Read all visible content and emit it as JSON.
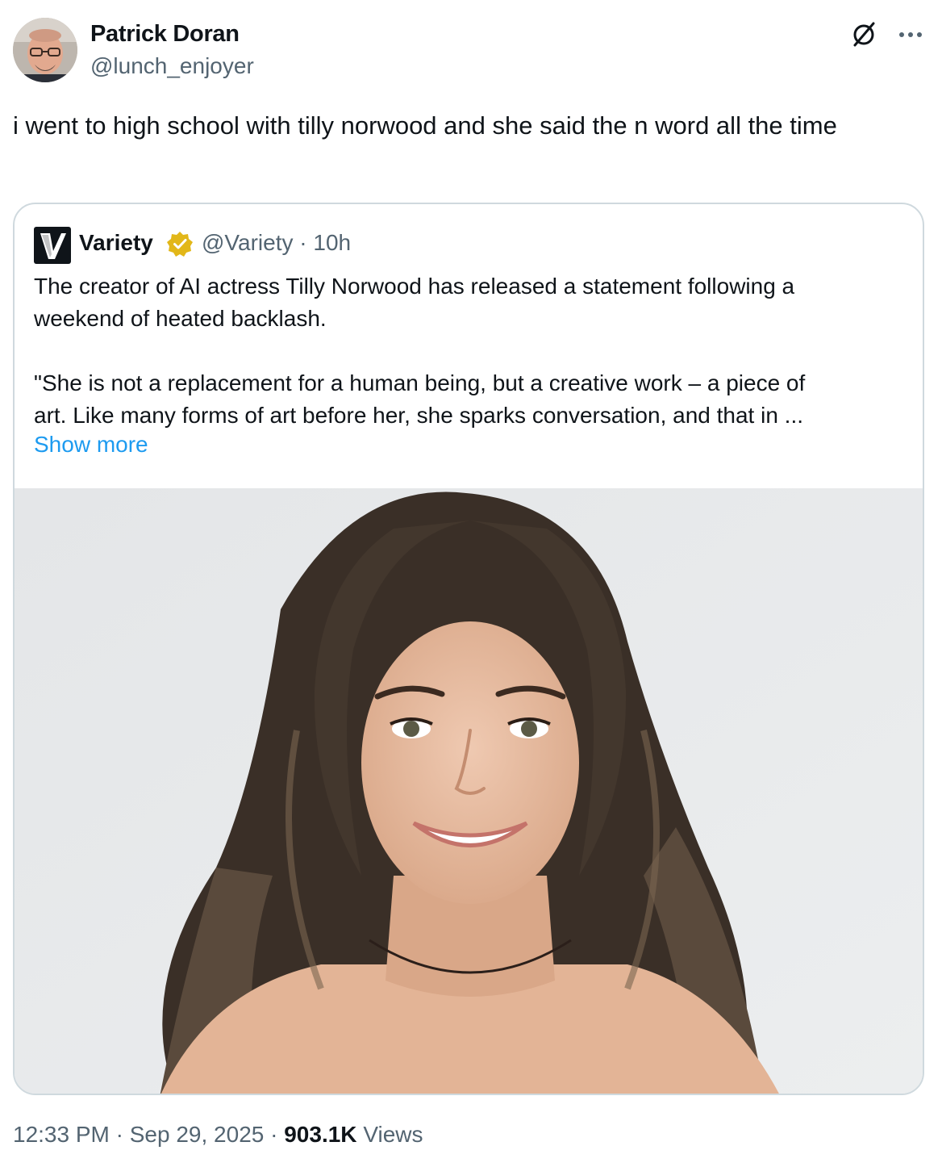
{
  "author": {
    "name": "Patrick Doran",
    "handle": "@lunch_enjoyer"
  },
  "icons": {
    "grok": "grok-icon",
    "more": "more-icon",
    "verified": "verified-badge-icon"
  },
  "tweet": {
    "text": "i went to high school with tilly norwood and she said the n word all the time"
  },
  "quote": {
    "name": "Variety",
    "handle": "@Variety",
    "separator": "·",
    "age": "10h",
    "lines": [
      "The creator of AI actress Tilly Norwood has released a statement following a",
      "weekend of heated backlash.",
      "\"She is not a replacement for a human being, but a creative work – a piece of",
      "art. Like many forms of art before her, she sparks conversation, and that in ..."
    ],
    "show_more": "Show more"
  },
  "footer": {
    "time": "12:33 PM",
    "separator": "·",
    "date": "Sep 29, 2025",
    "views_count": "903.1K",
    "views_label": "Views"
  },
  "colors": {
    "text": "#0f1419",
    "secondary": "#536471",
    "link": "#1d9bf0",
    "border": "#cfd9de",
    "verified_gold": "#e2b719"
  }
}
